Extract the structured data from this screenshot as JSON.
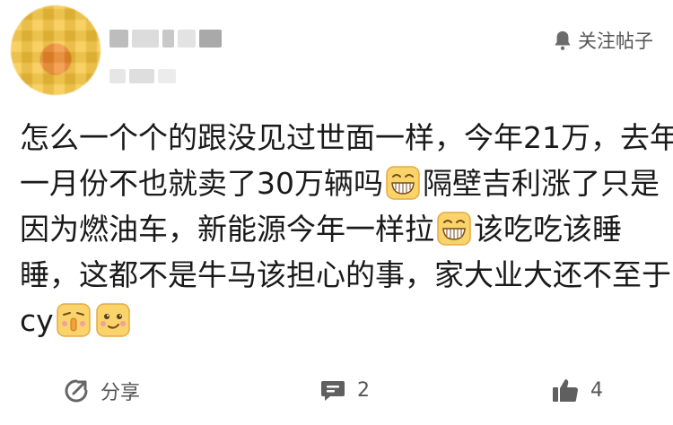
{
  "header": {
    "follow_label": "关注帖子",
    "icons": {
      "follow": "bell-icon"
    }
  },
  "post": {
    "lines": [
      "怎么一个个的跟没见过世面一样，今年21万，去年",
      "一月份不也就卖了30万辆吗",
      "隔壁吉利涨了只是",
      "因为燃油车，新能源今年一样拉",
      "该吃吃该睡",
      "睡，这都不是牛马该担心的事，家大业大还不至于",
      "cy"
    ],
    "emojis": [
      "grin-emoji",
      "grin-emoji",
      "shh-emoji",
      "smirk-emoji"
    ]
  },
  "footer": {
    "share_label": "分享",
    "comment_count": "2",
    "like_count": "4",
    "icons": {
      "share": "share-icon",
      "comment": "comment-icon",
      "like": "thumbs-up-icon"
    }
  },
  "colors": {
    "text": "#1a1a1a",
    "muted": "#555555",
    "emoji_yellow": "#f9d46a",
    "emoji_orange": "#f0a23a"
  }
}
